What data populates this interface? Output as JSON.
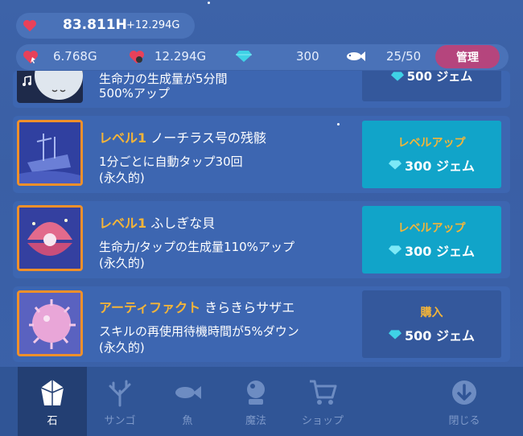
{
  "topbar": {
    "life_total": "83.811H",
    "life_rate": "+12.294G",
    "stat_tap": "6.768G",
    "stat_auto": "12.294G",
    "gems": "300",
    "fish": "25/50",
    "manage_label": "管理"
  },
  "partial_card": {
    "desc_line1": "生命力の生成量が5分間",
    "desc_line2": "500%アップ",
    "cost": "500 ジェム"
  },
  "cards": [
    {
      "level": "レベル1",
      "name": "ノーチラス号の残骸",
      "desc_line1": "1分ごとに自動タップ30回",
      "desc_line2": "(永久的)",
      "button_label": "レベルアップ",
      "cost": "300 ジェム"
    },
    {
      "level": "レベル1",
      "name": "ふしぎな貝",
      "desc_line1": "生命力/タップの生成量110%アップ",
      "desc_line2": "(永久的)",
      "button_label": "レベルアップ",
      "cost": "300 ジェム"
    },
    {
      "level": "アーティファクト",
      "name": "きらきらサザエ",
      "desc_line1": "スキルの再使用待機時間が5%ダウン",
      "desc_line2": "(永久的)",
      "button_label": "購入",
      "cost": "500 ジェム"
    }
  ],
  "nav": {
    "stone": "石",
    "coral": "サンゴ",
    "fish": "魚",
    "magic": "魔法",
    "shop": "ショップ",
    "close": "閉じる"
  },
  "colors": {
    "accent_orange": "#f5b538",
    "button_cyan": "#11a4c9",
    "manage_pink": "#b5457d"
  }
}
